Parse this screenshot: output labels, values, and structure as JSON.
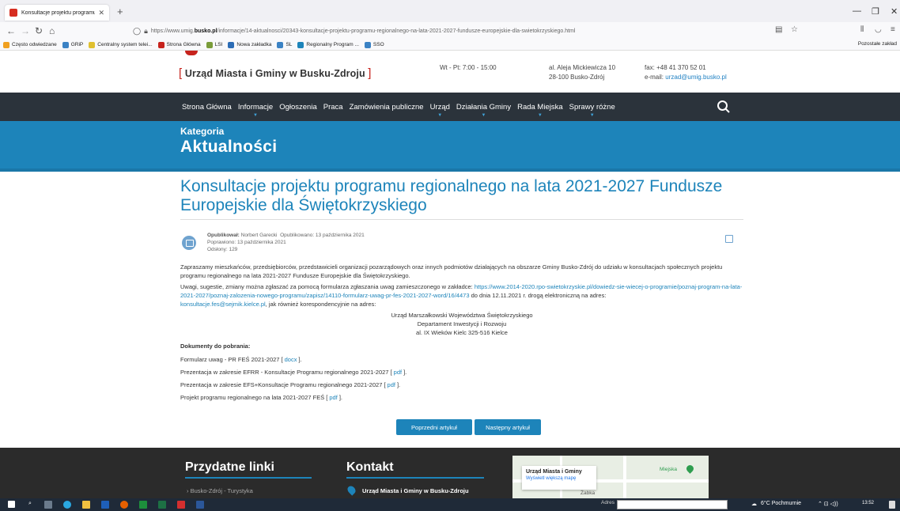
{
  "browser": {
    "tab_title": "Konsultacje projektu programu",
    "new_tab": "+",
    "url_prefix": "https://www.umig.",
    "url_domain": "busko.pl",
    "url_rest": "/informacje/14-aktualnosci/20343-konsultacje-projektu-programu-regionalnego-na-lata-2021-2027-fundusze-europejskie-dla-swietokrzyskiego.html",
    "bookmarks": [
      {
        "label": "Często odwiedzane",
        "color": "#f0a020"
      },
      {
        "label": "GRiP",
        "color": "#3b82c4"
      },
      {
        "label": "Centralny system telei...",
        "color": "#e0c030"
      },
      {
        "label": "Strona Główna",
        "color": "#c7231d"
      },
      {
        "label": "LSI",
        "color": "#7a9c3a"
      },
      {
        "label": "Nowa zakładka",
        "color": "#2c6cb5"
      },
      {
        "label": "SL",
        "color": "#3b82c4"
      },
      {
        "label": "Regionalny Program ...",
        "color": "#1d84ba"
      },
      {
        "label": "SSO",
        "color": "#3b82c4"
      }
    ],
    "bookmarks_other": "Pozostałe zakład"
  },
  "header": {
    "logo": "Urząd Miasta i Gminy w Busku-Zdroju",
    "hours": "Wt - Pt: 7:00 - 15:00",
    "address_line1": "al. Aleja Mickiewicza 10",
    "address_line2": "28-100 Busko-Zdrój",
    "fax": "fax: +48 41 370 52 01",
    "email_label": "e-mail:",
    "email": "urzad@umig.busko.pl"
  },
  "nav": {
    "items": [
      {
        "label": "Strona Główna",
        "caret": false
      },
      {
        "label": "Informacje",
        "caret": true
      },
      {
        "label": "Ogłoszenia",
        "caret": false
      },
      {
        "label": "Praca",
        "caret": false
      },
      {
        "label": "Zamówienia publiczne",
        "caret": false
      },
      {
        "label": "Urząd",
        "caret": true
      },
      {
        "label": "Działania Gminy",
        "caret": true
      },
      {
        "label": "Rada Miejska",
        "caret": true
      },
      {
        "label": "Sprawy różne",
        "caret": true
      }
    ]
  },
  "category": {
    "label": "Kategoria",
    "title": "Aktualności"
  },
  "article": {
    "title": "Konsultacje projektu programu regionalnego na lata 2021-2027 Fundusze Europejskie dla Świętokrzyskiego",
    "author_label": "Opublikował:",
    "author": "Norbert Garecki",
    "published": "Opublikowano: 13 października 2021",
    "corrected": "Poprawiono: 13 października 2021",
    "views": "Odsłony: 129",
    "para1": "Zapraszamy mieszkańców, przedsiębiorców, przedstawicieli organizacji pozarządowych oraz innych podmiotów działających na obszarze Gminy Busko-Zdrój do udziału w konsultacjach społecznych projektu programu regionalnego na lata 2021-2027 Fundusze Europejskie dla Świętokrzyskiego.",
    "para2_start": "Uwagi, sugestie, zmiany można zgłaszać za pomocą formularza zgłaszania uwag zamieszczonego w zakładce:",
    "para2_link": "https://www.2014-2020.rpo-swietokrzyskie.pl/dowiedz-sie-wiecej-o-programie/poznaj-program-na-lata-2021-2027/poznaj-zalozenia-nowego-programu/zapisz/14110-formularz-uwag-pr-fes-2021-2027-word/16/4473",
    "para2_mid": "do dnia 12.11.2021 r. drogą elektroniczną na adres:",
    "para2_email": "konsultacje.fes@sejmik.kielce.pl",
    "para2_end": ", jak również korespondencyjnie na adres:",
    "addr1": "Urząd Marszałkowski Województwa Świętokrzyskiego",
    "addr2": "Departament Inwestycji i Rozwoju",
    "addr3": "al. IX Wieków Kielc 325-516 Kielce",
    "docs_heading": "Dokumenty do pobrania:",
    "docs": [
      {
        "text": "Formularz uwag - PR FEŚ 2021-2027 [",
        "link": "docx",
        "end": "]."
      },
      {
        "text": "Prezentacja w zakresie EFRR - Konsultacje Programu regionalnego 2021-2027 [",
        "link": "pdf",
        "end": "]."
      },
      {
        "text": "Prezentacja w zakresie EFS+Konsultacje Programu regionalnego 2021-2027 [",
        "link": "pdf",
        "end": "]."
      },
      {
        "text": "Projekt programu regionalnego na lata 2021-2027 FEŚ [",
        "link": "pdf",
        "end": "]."
      }
    ],
    "prev_button": "Poprzedni artykuł",
    "next_button": "Następny artykuł"
  },
  "footer": {
    "links_heading": "Przydatne linki",
    "link1": "› Busko-Zdrój - Turystyka",
    "contact_heading": "Kontakt",
    "contact_name": "Urząd Miasta i Gminy w Busku-Zdroju",
    "map_title": "Urząd Miasta i Gminy",
    "map_link": "Wyświetl większą mapę",
    "map_label1": "Miejska",
    "map_label2": "Żabka"
  },
  "taskbar": {
    "address_label": "Adres",
    "weather": "6°C Pochmurnie",
    "time": "13:52"
  }
}
